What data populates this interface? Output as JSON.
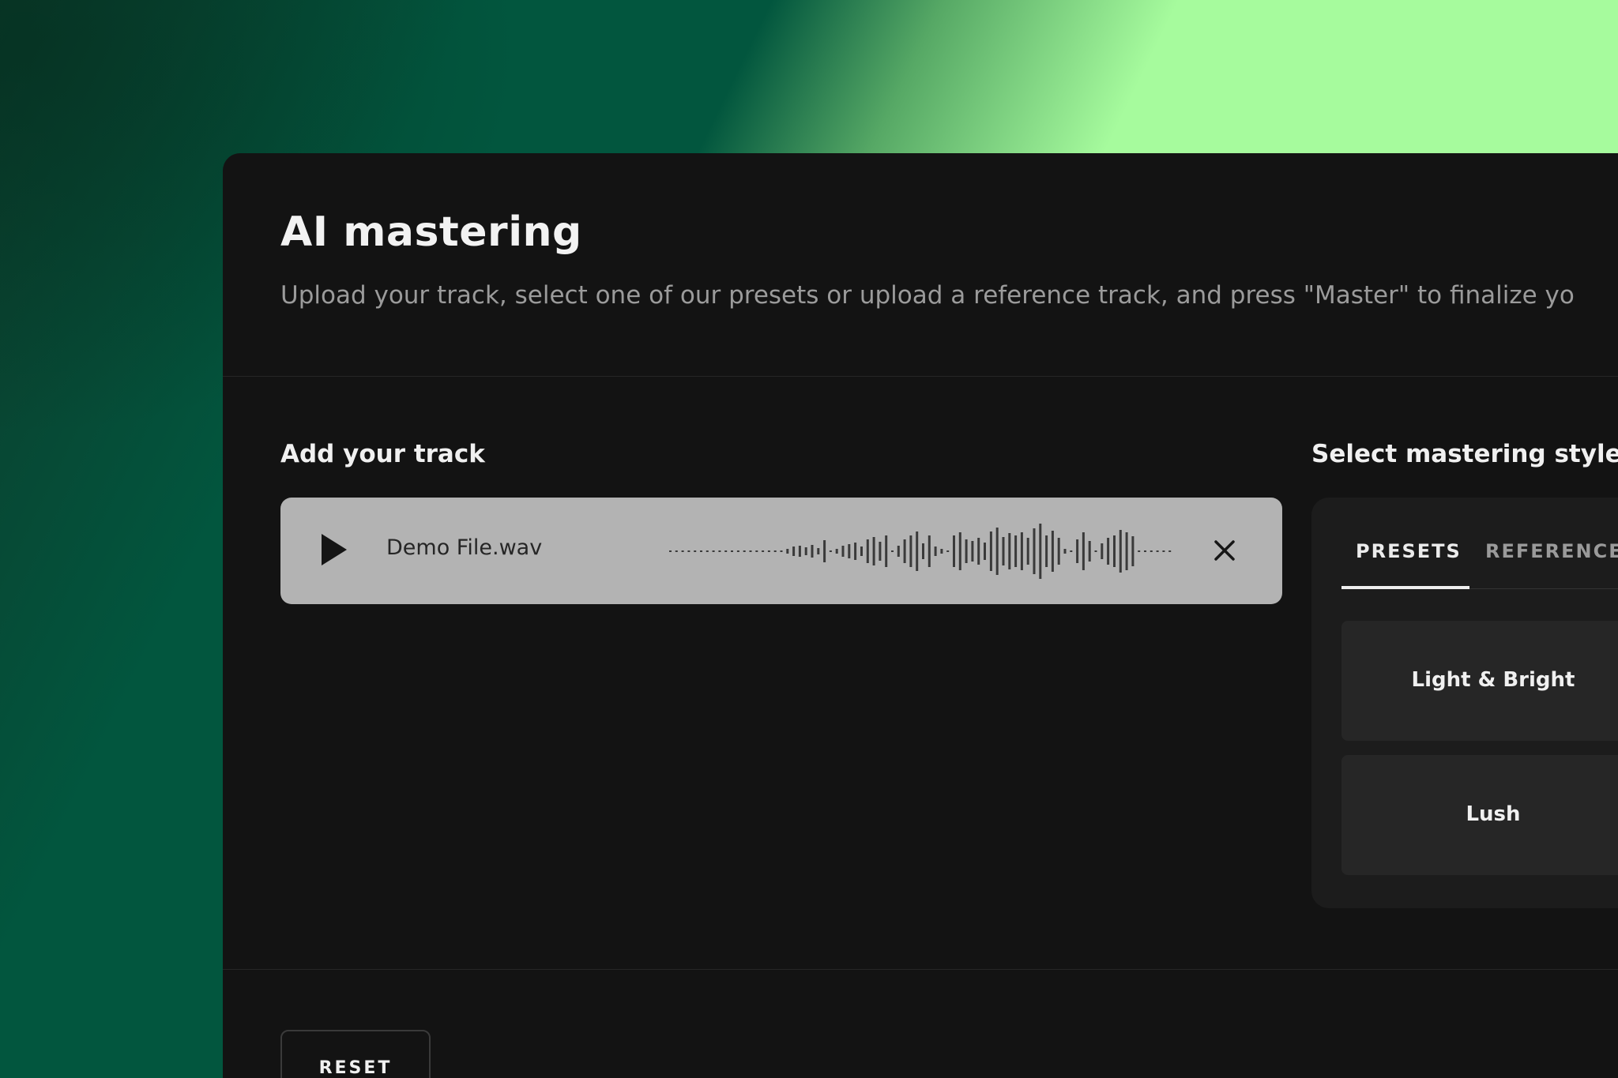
{
  "page": {
    "title": "AI mastering",
    "subtitle": "Upload your track, select one of our presets or upload a reference track, and press \"Master\" to finalize yo"
  },
  "track_section": {
    "label": "Add your track",
    "file_name": "Demo File.wav",
    "play_icon": "play-icon",
    "remove_icon": "close-icon"
  },
  "style_section": {
    "label": "Select mastering style",
    "tabs": [
      {
        "label": "PRESETS",
        "selected": true
      },
      {
        "label": "REFERENCE",
        "selected": false
      }
    ],
    "presets": [
      {
        "label": "Light & Bright"
      },
      {
        "label": "Lush"
      }
    ]
  },
  "footer": {
    "reset_label": "RESET"
  },
  "colors": {
    "panel_bg": "#131313",
    "track_card_bg": "#b3b3b3",
    "accent_green": "#a6fb9d",
    "dark_green": "#02563e"
  }
}
